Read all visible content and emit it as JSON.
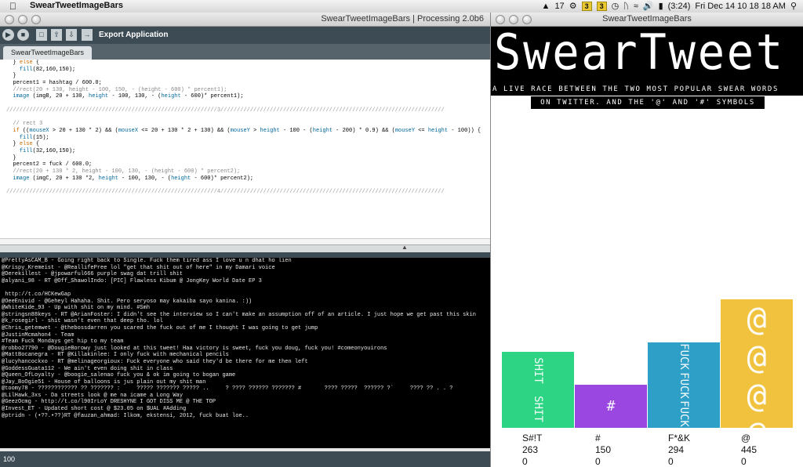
{
  "menubar": {
    "apple_icon": "apple-icon",
    "app_name": "SwearTweetImageBars",
    "status_items": [
      "17",
      "3",
      "3",
      "(3:24)",
      "Fri Dec 14  10 18 18 AM"
    ]
  },
  "pde": {
    "window_title": "SwearTweetImageBars | Processing 2.0b6",
    "export_label": "Export Application",
    "tab_label": "SwearTweetImageBars",
    "code_lines": [
      "  } else {",
      "    fill(82,160,150);",
      "  }",
      "  percent1 = hashtag / 600.0;",
      "  //rect(20 + 130, height - 100, 150, - (height - 600) * percent1);",
      "  image (imgB, 20 + 130, height - 100, 130, - (height - 600)* percent1);",
      "",
      "////////////////////////////////////////////////////////////////3////////////////////////////////////////////////////////////////////",
      "",
      "  // rect 3",
      "  if ((mouseX > 20 + 130 * 2) && (mouseX <= 20 + 130 * 2 + 130) && (mouseY > height - 100 - (height - 200) * 0.9) && (mouseY <= height - 100)) {",
      "    fill(15);",
      "  } else {",
      "    fill(32,160,150);",
      "  }",
      "  percent2 = fuck / 600.0;",
      "  //rect(20 + 130 * 2, height - 100, 130, - (height - 600) * percent2);",
      "  image (imgC, 20 + 130 *2, height - 100, 130, - (height - 600)* percent2);",
      "",
      "////////////////////////////////////////////////////////////////4////////////////////////////////////////////////////////////////////"
    ],
    "console_lines": [
      "@PrettyAsCAM_B - Going right back to Single. Fuck them tired ass I love u n dhat ho lien",
      "@Krispy_Kremeist - @ReallifePree lol \"get that shit out of here\" in my Damari voice",
      "@Derekillest - @jpowarful666 purple swag dat trill shit",
      "@alyani_98 - RT @Off_ShawolIndo: [PIC] Flawless Kibum @ JongKey World Date EP 3",
      "",
      " http://t.co/HCKewGap",
      "@OeeEnivid - @Geheyl Hahaha. Shit. Pero seryoso may kakaiba sayo kanina. :))",
      "@WhiteKide_93 - Up with shit on my mind. #Smh",
      "@stringsn88keys - RT @ArianFoster: I didn't see the interview so I can't make an assumption off of an article. I just hope we get past this skin",
      "@k_rosegirl - shit wasn't even that deep tho. lol",
      "@Chris_getemwet - @thebossdarren you scared the fuck out of me I thought I was going to get jump",
      "@JustinMcmahon4 - Team",
      "#Team Fuck Mondays get hip to my team",
      "@robbo27790 - @DougieBorowy just looked at this tweet! Haa victory is sweet, fuck you doug, fuck you! #comeonyouirons",
      "@MattBocanegra - RT @Killakinlee: I only fuck with mechanical pencils",
      "@lucyhancockxo - RT @melinageorgioux: Fuck everyone who said they'd be there for me then left",
      "@GoddessGuata112 - We ain't even doing shit in class",
      "@Queen_OfLoyalty - @boogie_salenao fuck you & ok im going to bogan game",
      "@Jay_BoOgie51 - House of balloons is jus plain out my shit man",
      "@toomy78 - ???????????? ?? ??????? :     ????? ??????? ????? ..     ? ???? ?????? ??????? #       ???? ?????  ?????? ?`     ???? ?? . . ?",
      "@LilHawk_3xs - Da streets look @ me na icame a Long Way",
      "@GeezOcmg - http://t.co/l90IrLoY DRESHYNE I GOT DISS ME @ THE TOP",
      "@Invest_ET - Updated short cost @ $23.05 on $UAL #Adding",
      "@ptridn - (•??.•??)RT @fauzan_ahmad: Ilkom, ekstensi, 2012, fuck buat loe.."
    ],
    "line_number": "100"
  },
  "sketch": {
    "window_title": "SwearTweetImageBars",
    "logo_text": "SwearTweet",
    "subtitle_line1": "A LIVE RACE BETWEEN THE TWO MOST POPULAR SWEAR WORDS",
    "subtitle_line2": "ON TWITTER. AND THE '@' AND '#' SYMBOLS"
  },
  "chart_data": {
    "type": "bar",
    "categories": [
      "S#!T",
      "#",
      "F*&K",
      "@"
    ],
    "values": [
      263,
      150,
      294,
      445
    ],
    "secondary_values": [
      0,
      0,
      0,
      0
    ],
    "colors": [
      "#2dd484",
      "#9a46e0",
      "#2e9fc7",
      "#f0c23d"
    ],
    "glyphs": [
      "SHIT",
      "#",
      "FUCK",
      "@"
    ],
    "ylim": [
      0,
      500
    ]
  }
}
